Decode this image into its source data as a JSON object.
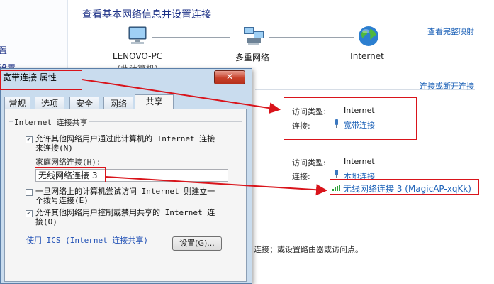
{
  "page": {
    "title": "查看基本网络信息并设置连接",
    "full_map_link": "查看完整映射",
    "left_nav": [
      "置",
      "设置"
    ],
    "nodes": [
      {
        "label": "LENOVO-PC",
        "sublabel": "(此计算机)"
      },
      {
        "label": "多重网络",
        "sublabel": ""
      },
      {
        "label": "Internet",
        "sublabel": ""
      }
    ],
    "connect_link": "连接或断开连接",
    "connections": [
      {
        "access_label": "访问类型:",
        "access_value": "Internet",
        "conn_label": "连接:",
        "conn_value": "宽带连接"
      },
      {
        "access_label": "访问类型:",
        "access_value": "Internet",
        "conn_label": "连接:",
        "conn_value": "本地连接",
        "conn_value2": "无线网络连接 3 (MagicAP-xqKk)"
      }
    ],
    "bottom_text": "连接；或设置路由器或访问点。"
  },
  "dialog": {
    "title": "宽带连接 属性",
    "close_glyph": "✕",
    "tabs": [
      "常规",
      "选项",
      "安全",
      "网络",
      "共享"
    ],
    "active_tab": 4,
    "group_title": "Internet 连接共享",
    "opt1_line1": "允许其他网络用户通过此计算机的 Internet 连接",
    "opt1_line2": "来连接(N)",
    "home_label": "家庭网络连接(H):",
    "home_value": "无线网络连接 3",
    "opt2_line1": "一旦网络上的计算机尝试访问 Internet 则建立一",
    "opt2_line2": "个拨号连接(E)",
    "opt3_line1": "允许其他网络用户控制或禁用共享的 Internet 连",
    "opt3_line2": "接(O)",
    "ics_link": "使用 ICS (Internet 连接共享)",
    "settings_button": "设置(G)...",
    "check_glyph": "✓"
  },
  "colors": {
    "accent_red": "#d9141b",
    "link_blue": "#1f63b8",
    "heading_blue": "#1e3287"
  }
}
